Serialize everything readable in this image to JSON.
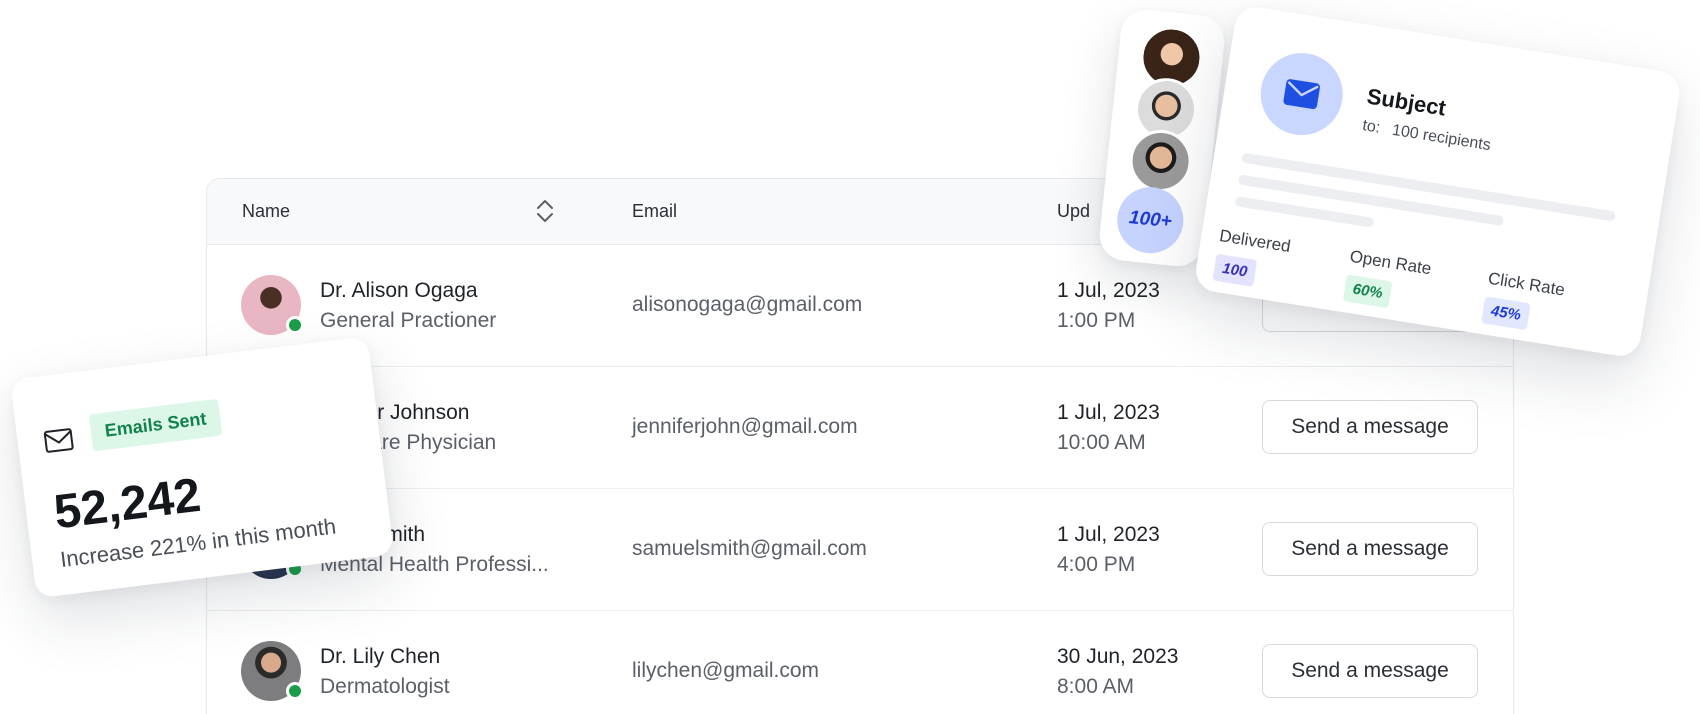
{
  "table": {
    "headers": {
      "name": "Name",
      "email": "Email",
      "updated": "Upd"
    },
    "rows": [
      {
        "name": "Dr. Alison Ogaga",
        "role": "General Practioner",
        "email": "alisonogaga@gmail.com",
        "date": "1 Jul, 2023",
        "time": "1:00 PM",
        "action": ""
      },
      {
        "name": "ennifer Johnson",
        "role": "ary Care Physician",
        "email": "jenniferjohn@gmail.com",
        "date": "1 Jul, 2023",
        "time": "10:00 AM",
        "action": "Send a message"
      },
      {
        "name": "muel Smith",
        "role": "Mental Health Professi...",
        "email": "samuelsmith@gmail.com",
        "date": "1 Jul, 2023",
        "time": "4:00 PM",
        "action": "Send a message"
      },
      {
        "name": "Dr. Lily Chen",
        "role": "Dermatologist",
        "email": "lilychen@gmail.com",
        "date": "30 Jun, 2023",
        "time": "8:00 AM",
        "action": "Send a message"
      }
    ]
  },
  "stat_card": {
    "badge": "Emails Sent",
    "number": "52,242",
    "caption": "Increase 221% in this month"
  },
  "recipients_strip": {
    "more": "100+"
  },
  "subject_card": {
    "title": "Subject",
    "to_label": "to:",
    "recipients": "100 recipients",
    "metrics": [
      {
        "label": "Delivered",
        "value": "100",
        "color": "#3a2fb8",
        "bg": "#e4e3ff"
      },
      {
        "label": "Open Rate",
        "value": "60%",
        "color": "#12824a",
        "bg": "#dcf7e8"
      },
      {
        "label": "Click Rate",
        "value": "45%",
        "color": "#1e3ad6",
        "bg": "#e0e7ff"
      }
    ]
  },
  "colors": {
    "accent_blue": "#1f4fe0",
    "online_green": "#1a9e49"
  }
}
